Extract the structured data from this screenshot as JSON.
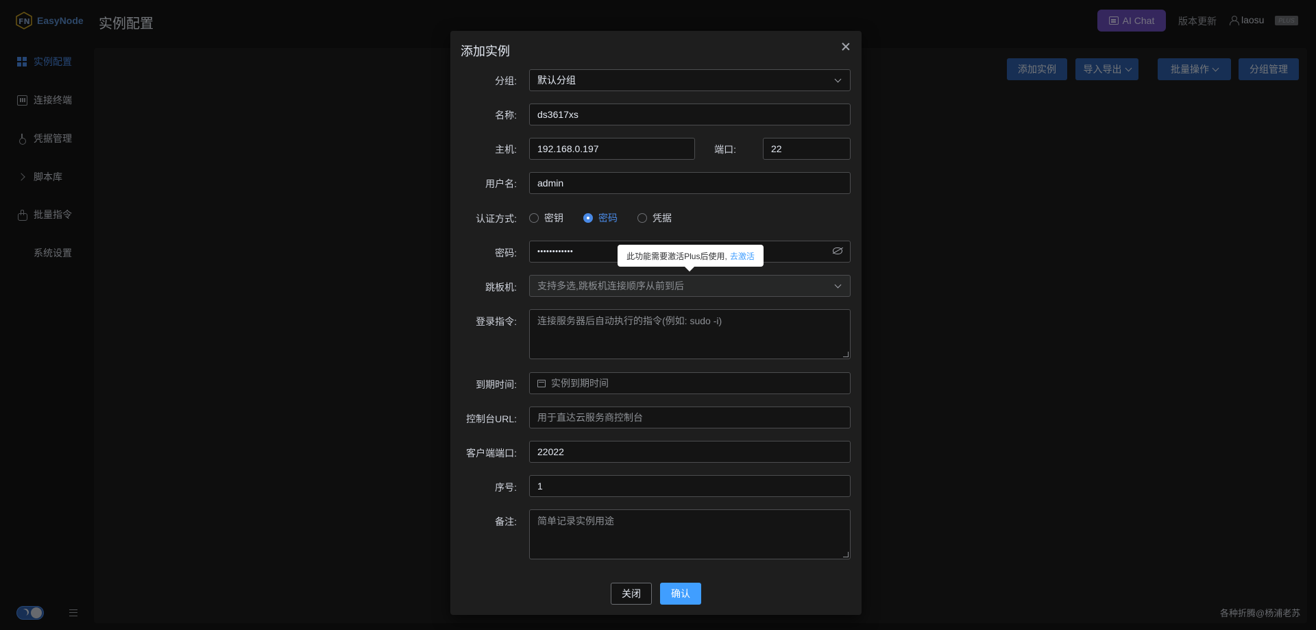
{
  "header": {
    "logo_text": "EasyNode",
    "page_title": "实例配置",
    "ai_chat_label": "AI Chat",
    "version_update": "版本更新",
    "username": "laosu",
    "plus_badge": "PLUS"
  },
  "sidebar": {
    "items": [
      {
        "label": "实例配置",
        "icon": "grid-icon"
      },
      {
        "label": "连接终端",
        "icon": "terminal-icon"
      },
      {
        "label": "凭据管理",
        "icon": "key-icon"
      },
      {
        "label": "脚本库",
        "icon": "chevron-right-icon"
      },
      {
        "label": "批量指令",
        "icon": "hand-icon"
      },
      {
        "label": "系统设置",
        "icon": ""
      }
    ]
  },
  "toolbar": {
    "add_instance": "添加实例",
    "import_export": "导入导出",
    "batch_ops": "批量操作",
    "group_manage": "分组管理"
  },
  "footer": {
    "watermark": "各种折腾@杨浦老苏"
  },
  "dialog": {
    "title": "添加实例",
    "group": {
      "label": "分组:",
      "value": "默认分组"
    },
    "name": {
      "label": "名称:",
      "value": "ds3617xs"
    },
    "host": {
      "label": "主机:",
      "value": "192.168.0.197"
    },
    "port": {
      "label": "端口:",
      "value": "22"
    },
    "username": {
      "label": "用户名:",
      "value": "admin"
    },
    "auth": {
      "label": "认证方式:",
      "options": [
        "密钥",
        "密码",
        "凭据"
      ],
      "selected": "密码"
    },
    "password": {
      "label": "密码:",
      "value": "••••••••••••"
    },
    "tooltip": {
      "text": "此功能需要激活Plus后使用,",
      "link": "去激活"
    },
    "jump_host": {
      "label": "跳板机:",
      "placeholder": "支持多选,跳板机连接顺序从前到后"
    },
    "login_cmd": {
      "label": "登录指令:",
      "placeholder": "连接服务器后自动执行的指令(例如: sudo -i)"
    },
    "expire": {
      "label": "到期时间:",
      "placeholder": "实例到期时间"
    },
    "console_url": {
      "label": "控制台URL:",
      "placeholder": "用于直达云服务商控制台"
    },
    "client_port": {
      "label": "客户端端口:",
      "value": "22022"
    },
    "index": {
      "label": "序号:",
      "value": "1"
    },
    "remark": {
      "label": "备注:",
      "placeholder": "简单记录实例用途"
    },
    "close_button": "关闭",
    "confirm_button": "确认"
  }
}
